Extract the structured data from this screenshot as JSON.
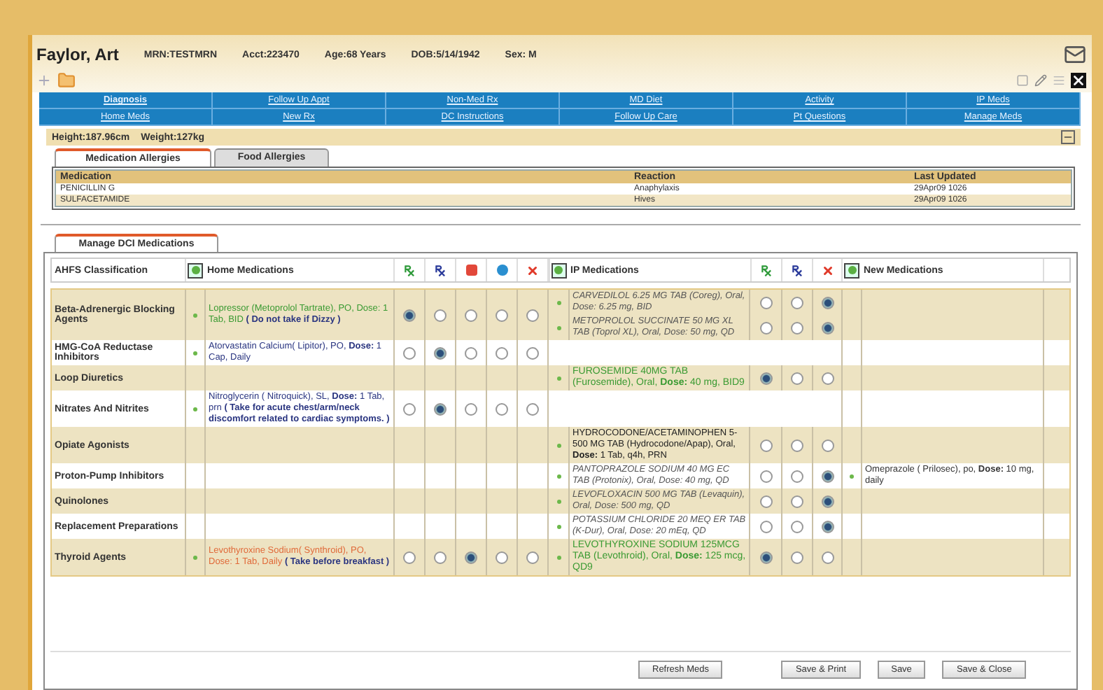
{
  "patient": {
    "name": "Faylor, Art",
    "fields": [
      "MRN:TESTMRN",
      "Acct:223470",
      "Age:68 Years",
      "DOB:5/14/1942",
      "Sex: M"
    ]
  },
  "nav": [
    [
      {
        "label": "Diagnosis",
        "selected": true
      },
      {
        "label": "Follow Up Appt",
        "selected": false
      },
      {
        "label": "Non-Med Rx",
        "selected": false
      },
      {
        "label": "MD Diet",
        "selected": false
      },
      {
        "label": "Activity",
        "selected": false
      },
      {
        "label": "IP Meds",
        "selected": false
      }
    ],
    [
      {
        "label": "Home Meds",
        "selected": false
      },
      {
        "label": "New Rx",
        "selected": false
      },
      {
        "label": "DC Instructions",
        "selected": false
      },
      {
        "label": "Follow Up Care",
        "selected": false
      },
      {
        "label": "Pt Questions",
        "selected": false
      },
      {
        "label": "Manage Meds",
        "selected": false
      }
    ]
  ],
  "vitals": [
    "Height:187.96cm",
    "Weight:127kg"
  ],
  "allergy_tabs": [
    {
      "label": "Medication Allergies",
      "selected": true
    },
    {
      "label": "Food Allergies",
      "selected": false
    }
  ],
  "allergies": {
    "columns": [
      "Medication",
      "Reaction",
      "Last Updated"
    ],
    "rows": [
      [
        "PENICILLIN G",
        "Anaphylaxis",
        "29Apr09 1026"
      ],
      [
        "SULFACETAMIDE",
        "Hives",
        "29Apr09 1026"
      ]
    ]
  },
  "meds_tab": {
    "label": "Manage DCI Medications",
    "selected": true
  },
  "med_columns": {
    "classification": "AHFS Classification",
    "home": "Home Medications",
    "ip": "IP Medications",
    "new": "New Medications"
  },
  "med_rows": [
    {
      "classification": "Beta-Adrenergic Blocking Agents",
      "home": {
        "kind": "continued",
        "text": "Lopressor (Metoprolol Tartrate), PO, Dose: 1 Tab, BID",
        "note": "( Do not take if Dizzy )"
      },
      "home_choices": [
        {
          "selected": true
        },
        {
          "selected": false
        },
        {
          "selected": false
        },
        {
          "selected": false
        },
        {
          "selected": false
        }
      ],
      "ip": [
        {
          "kind": "discontinued",
          "text": "CARVEDILOL 6.25 MG TAB (Coreg), Oral, Dose: 6.25 mg, BID",
          "choices": [
            {
              "selected": false
            },
            {
              "selected": false
            },
            {
              "selected": true
            }
          ]
        },
        {
          "kind": "discontinued",
          "text": "METOPROLOL SUCCINATE 50 MG XL TAB (Toprol XL), Oral, Dose: 50 mg, QD",
          "choices": [
            {
              "selected": false
            },
            {
              "selected": false
            },
            {
              "selected": true
            }
          ]
        }
      ]
    },
    {
      "classification": "HMG-CoA Reductase Inhibitors",
      "home": {
        "kind": "current",
        "text": "Atorvastatin Calcium( Lipitor), PO, **Dose:** 1 Cap, Daily"
      },
      "home_choices": [
        {
          "selected": false
        },
        {
          "selected": true
        },
        {
          "selected": false
        },
        {
          "selected": false
        },
        {
          "selected": false
        }
      ],
      "ip": []
    },
    {
      "classification": "Loop Diuretics",
      "ip": [
        {
          "kind": "added",
          "text": "FUROSEMIDE 40MG TAB (Furosemide), Oral, **Dose:** 40 mg, BID9",
          "choices": [
            {
              "selected": true
            },
            {
              "selected": false
            },
            {
              "selected": false
            }
          ]
        }
      ]
    },
    {
      "classification": "Nitrates And Nitrites",
      "home": {
        "kind": "current",
        "text": "Nitroglycerin ( Nitroquick), SL, **Dose:** 1 Tab, prn",
        "note": "( Take for acute chest/arm/neck discomfort related to cardiac symptoms. )"
      },
      "home_choices": [
        {
          "selected": false
        },
        {
          "selected": true
        },
        {
          "selected": false
        },
        {
          "selected": false
        },
        {
          "selected": false
        }
      ],
      "ip": []
    },
    {
      "classification": "Opiate Agonists",
      "ip": [
        {
          "kind": "existing",
          "text": "HYDROCODONE/ACETAMINOPHEN 5-500 MG TAB (Hydrocodone/Apap), Oral, **Dose:** 1 Tab, q4h, PRN",
          "choices": [
            {
              "selected": false
            },
            {
              "selected": false
            },
            {
              "selected": false
            }
          ]
        }
      ]
    },
    {
      "classification": "Proton-Pump Inhibitors",
      "ip": [
        {
          "kind": "discontinued",
          "text": "PANTOPRAZOLE SODIUM 40 MG EC TAB (Protonix), Oral, Dose: 40 mg, QD",
          "choices": [
            {
              "selected": false
            },
            {
              "selected": false
            },
            {
              "selected": true
            }
          ]
        }
      ],
      "new": "Omeprazole ( Prilosec), po, **Dose:** 10 mg, daily"
    },
    {
      "classification": "Quinolones",
      "ip": [
        {
          "kind": "discontinued",
          "text": "LEVOFLOXACIN 500 MG TAB (Levaquin), Oral, Dose: 500 mg, QD",
          "choices": [
            {
              "selected": false
            },
            {
              "selected": false
            },
            {
              "selected": true
            }
          ]
        }
      ]
    },
    {
      "classification": "Replacement Preparations",
      "ip": [
        {
          "kind": "discontinued",
          "text": "POTASSIUM CHLORIDE 20 MEQ ER TAB (K-Dur), Oral, Dose: 20 mEq, QD",
          "choices": [
            {
              "selected": false
            },
            {
              "selected": false
            },
            {
              "selected": true
            }
          ]
        }
      ]
    },
    {
      "classification": "Thyroid Agents",
      "home": {
        "kind": "modified",
        "text": "Levothyroxine Sodium( Synthroid), PO, Dose: 1 Tab, Daily",
        "note": "( Take before breakfast )"
      },
      "home_choices": [
        {
          "selected": false
        },
        {
          "selected": false
        },
        {
          "selected": true
        },
        {
          "selected": false
        },
        {
          "selected": false
        }
      ],
      "ip": [
        {
          "kind": "added",
          "text": "LEVOTHYROXINE SODIUM 125MCG TAB (Levothroid), Oral, **Dose:** 125 mcg, QD9",
          "choices": [
            {
              "selected": true
            },
            {
              "selected": false
            },
            {
              "selected": false
            }
          ]
        }
      ]
    }
  ],
  "buttons": [
    "Refresh Meds",
    "Save & Print",
    "Save",
    "Save & Close"
  ]
}
